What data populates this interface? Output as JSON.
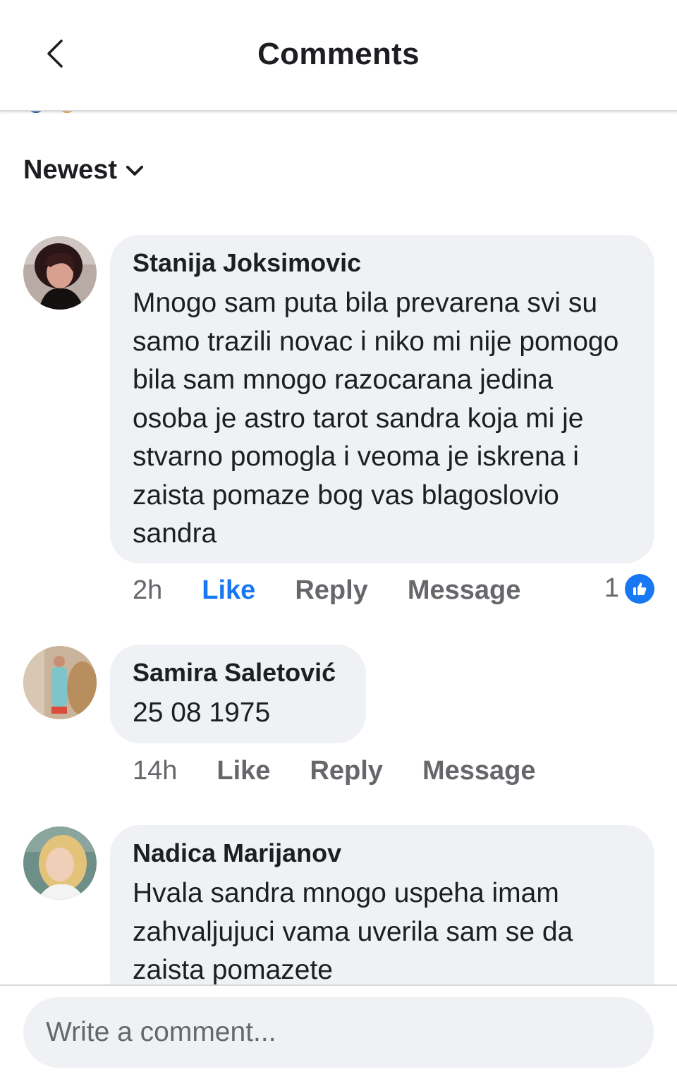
{
  "header": {
    "title": "Comments",
    "back_icon": "chevron-left-icon"
  },
  "sort": {
    "label": "Newest",
    "icon": "chevron-down-icon"
  },
  "comments": [
    {
      "author": "Stanija Joksimovic",
      "text": "Mnogo sam puta bila prevarena svi su samo trazili novac i niko mi nije pomogo bila sam mnogo razocarana jedina osoba je astro tarot sandra koja mi je stvarno pomogla i veoma je iskrena i zaista pomaze bog vas blagoslovio sandra",
      "time": "2h",
      "like": "Like",
      "reply": "Reply",
      "message": "Message",
      "liked": true,
      "reaction_count": "1"
    },
    {
      "author": "Samira Saletović",
      "text": "25 08 1975",
      "time": "14h",
      "like": "Like",
      "reply": "Reply",
      "message": "Message",
      "liked": false
    },
    {
      "author": "Nadica Marijanov",
      "text": "Hvala sandra mnogo uspeha imam zahvaljujuci vama uverila sam se da zaista pomazete"
    }
  ],
  "composer": {
    "placeholder": "Write a comment..."
  },
  "colors": {
    "accent": "#1877f2",
    "bubble": "#eff1f4",
    "muted": "#65676b"
  }
}
